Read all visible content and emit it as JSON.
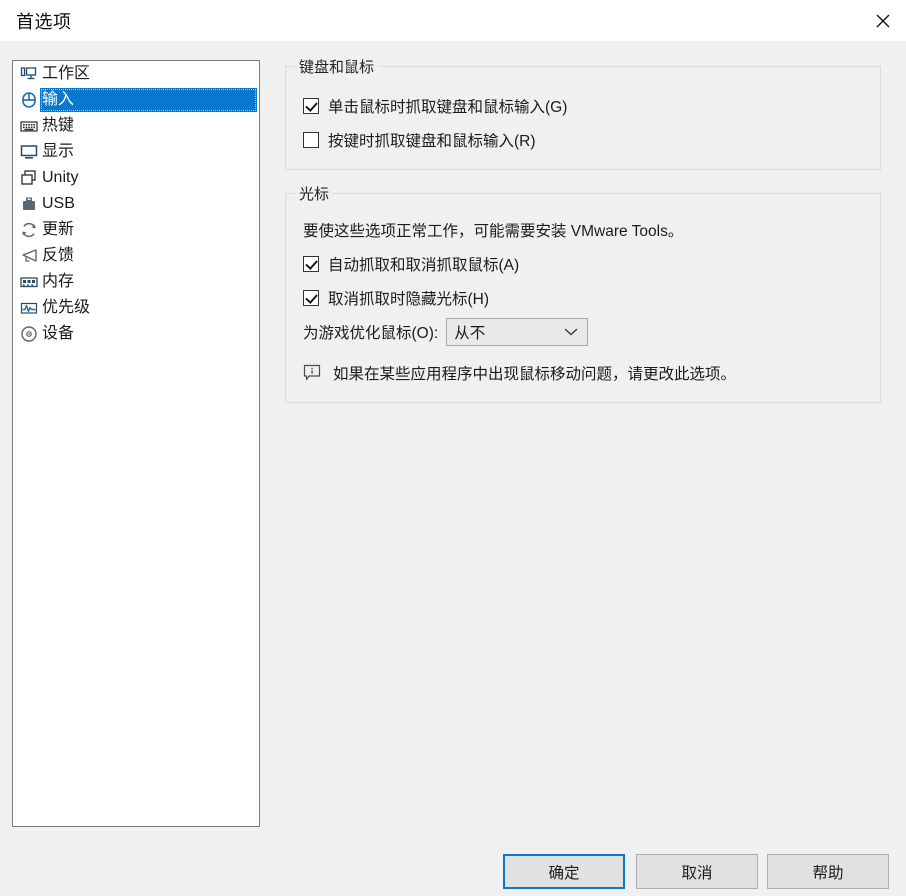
{
  "window": {
    "title": "首选项",
    "close_icon": "close-icon",
    "accent_color": "#0b78d0",
    "background_color": "#f0f0f0",
    "titlebar_color": "#ffffff"
  },
  "sidebar": {
    "items": [
      {
        "label": "工作区",
        "icon": "workspace-icon",
        "selected": false
      },
      {
        "label": "输入",
        "icon": "mouse-icon",
        "selected": true
      },
      {
        "label": "热键",
        "icon": "keyboard-icon",
        "selected": false
      },
      {
        "label": "显示",
        "icon": "display-icon",
        "selected": false
      },
      {
        "label": "Unity",
        "icon": "unity-icon",
        "selected": false
      },
      {
        "label": "USB",
        "icon": "usb-icon",
        "selected": false
      },
      {
        "label": "更新",
        "icon": "update-icon",
        "selected": false
      },
      {
        "label": "反馈",
        "icon": "feedback-icon",
        "selected": false
      },
      {
        "label": "内存",
        "icon": "memory-icon",
        "selected": false
      },
      {
        "label": "优先级",
        "icon": "priority-icon",
        "selected": false
      },
      {
        "label": "设备",
        "icon": "device-icon",
        "selected": false
      }
    ]
  },
  "groups": {
    "keyboard_mouse": {
      "title": "键盘和鼠标",
      "checkboxes": [
        {
          "label": "单击鼠标时抓取键盘和鼠标输入(G)",
          "checked": true
        },
        {
          "label": "按键时抓取键盘和鼠标输入(R)",
          "checked": false
        }
      ]
    },
    "cursor": {
      "title": "光标",
      "note": "要使这些选项正常工作，可能需要安装 VMware Tools。",
      "checkboxes": [
        {
          "label": "自动抓取和取消抓取鼠标(A)",
          "checked": true
        },
        {
          "label": "取消抓取时隐藏光标(H)",
          "checked": true
        }
      ],
      "combo": {
        "label": "为游戏优化鼠标(O):",
        "value": "从不",
        "arrow_icon": "chevron-down-icon"
      },
      "info": {
        "icon": "info-bubble-icon",
        "text": "如果在某些应用程序中出现鼠标移动问题，请更改此选项。"
      }
    }
  },
  "footer": {
    "ok_label": "确定",
    "cancel_label": "取消",
    "help_label": "帮助"
  }
}
